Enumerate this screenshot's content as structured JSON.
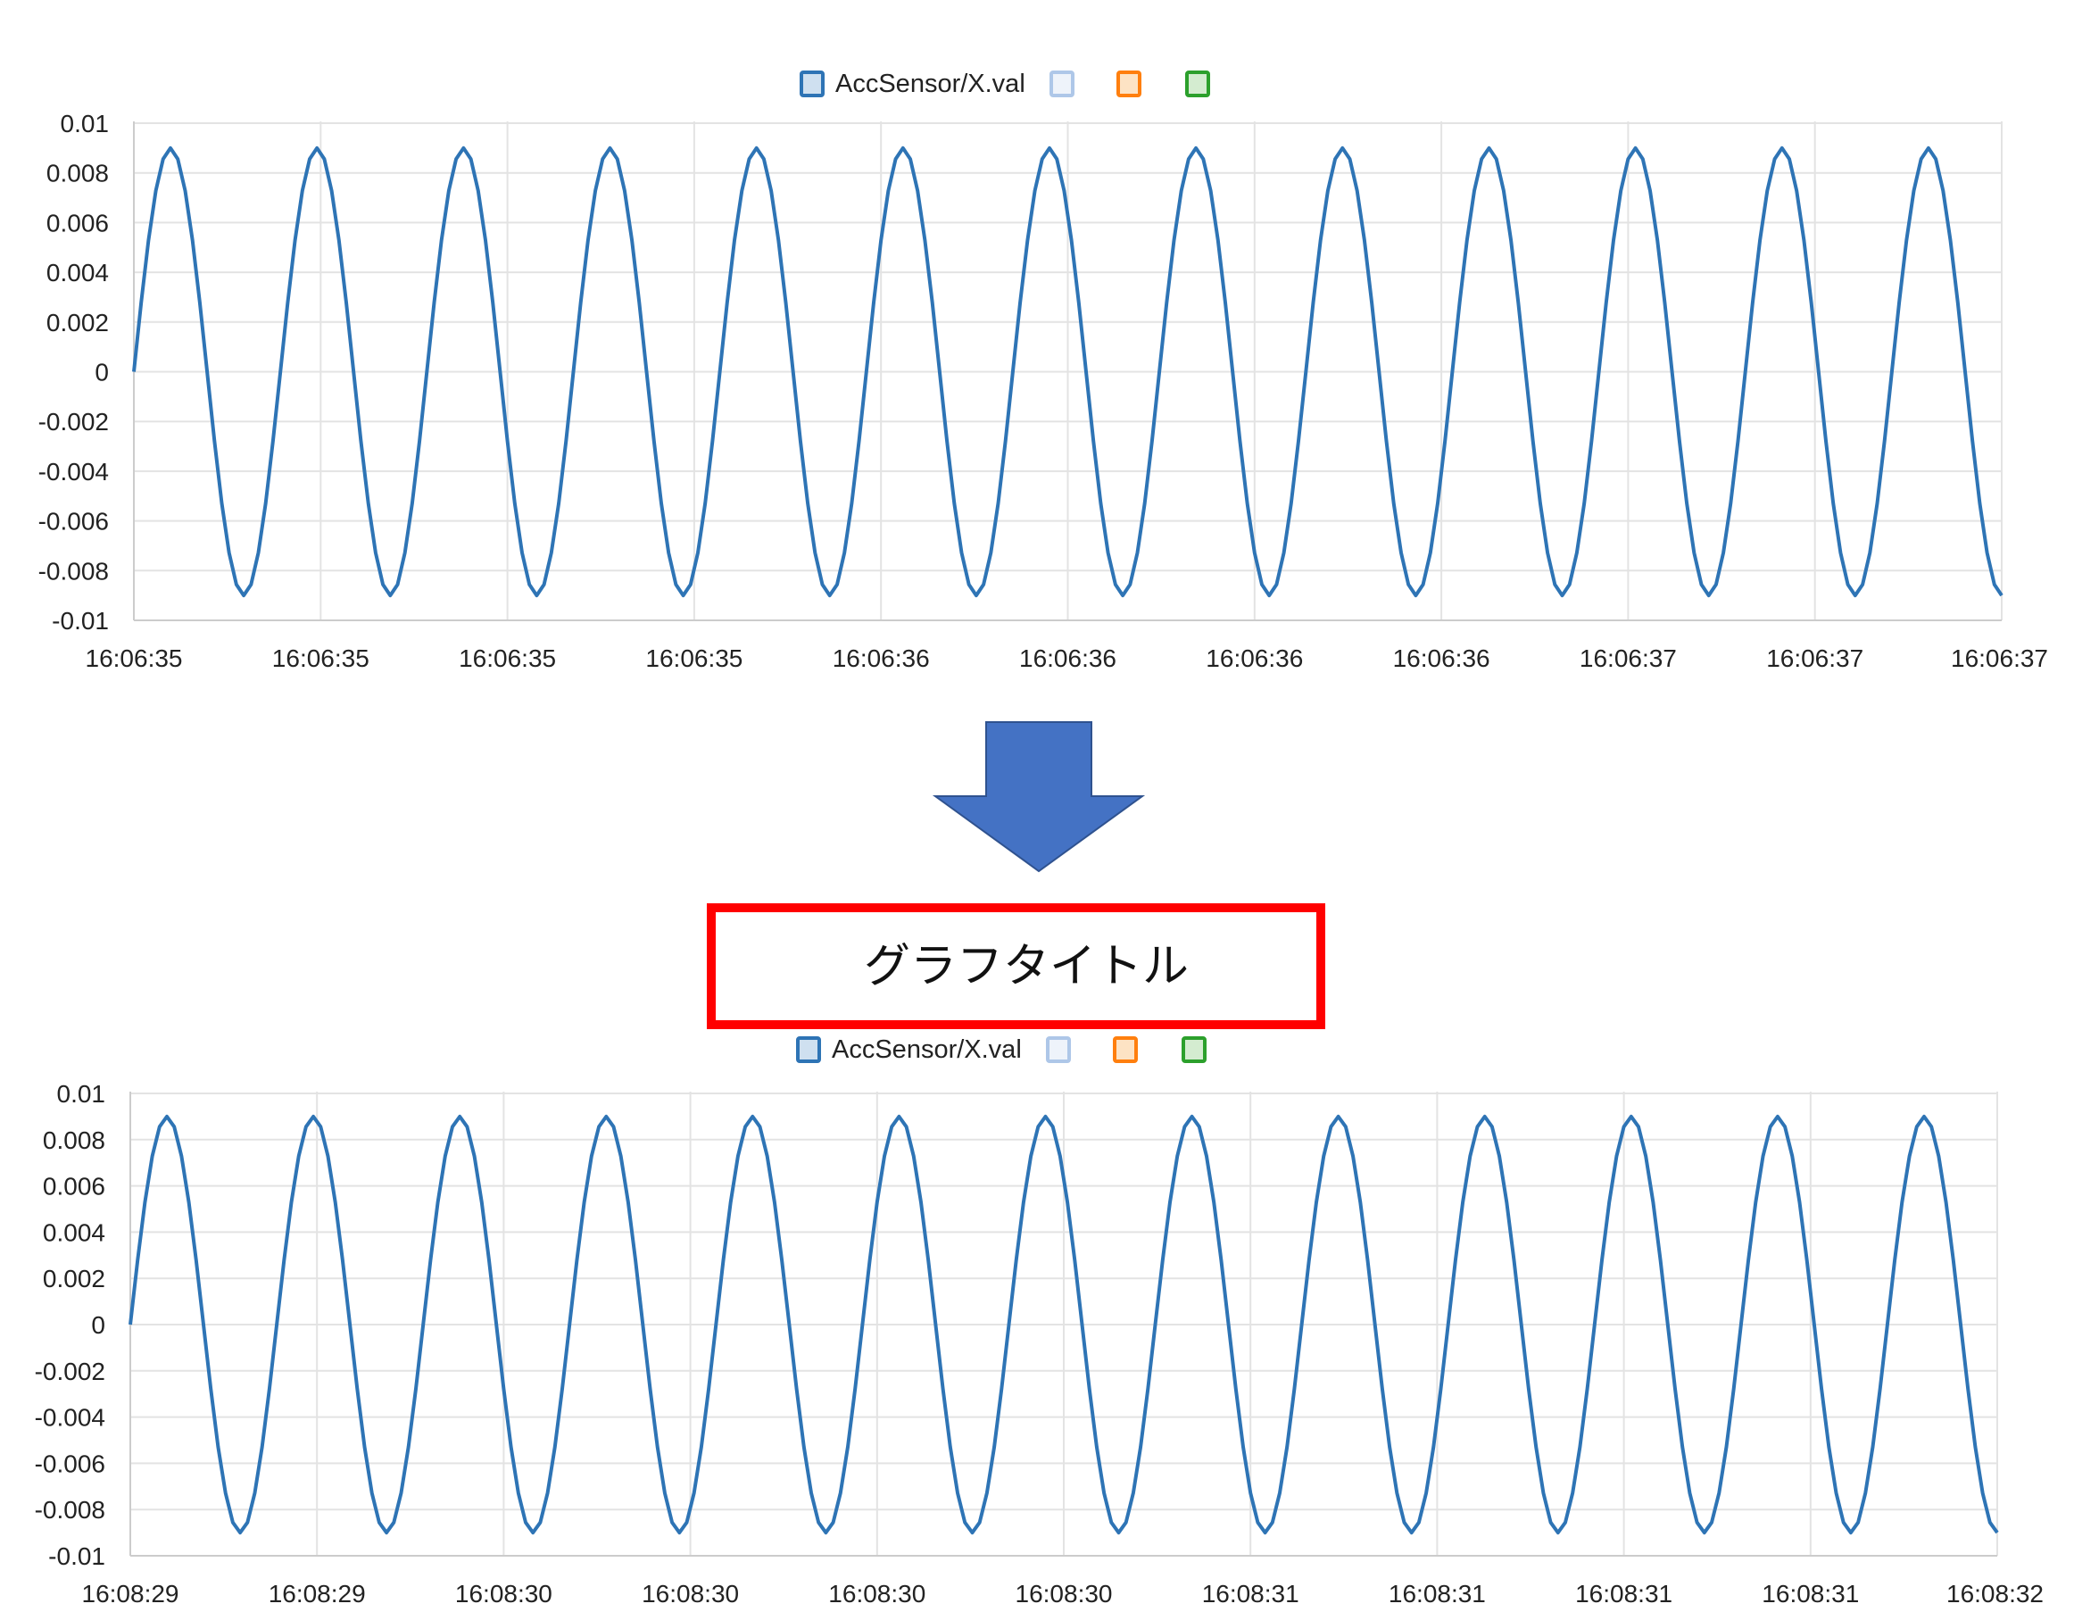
{
  "colors": {
    "series": "#2e74b5",
    "legend_swatches": [
      "#2e74b5",
      "#aec7e8",
      "#ff7f0e",
      "#2ca02c"
    ],
    "grid": "#e3e3e3",
    "axis": "#cccccc",
    "arrow_fill": "#4472c4",
    "arrow_stroke": "#2f528f",
    "title_box": "#ff0000"
  },
  "arrow": {
    "icon": "down-arrow-icon"
  },
  "chart_data": [
    {
      "type": "line",
      "title": "",
      "xlabel": "",
      "ylabel": "",
      "ylim": [
        -0.01,
        0.01
      ],
      "grid": true,
      "legend_placement": "top-center",
      "legend": [
        "AccSensor/X.val",
        "",
        "",
        ""
      ],
      "yticks": [
        "0.01",
        "0.008",
        "0.006",
        "0.004",
        "0.002",
        "0",
        "-0.002",
        "-0.004",
        "-0.006",
        "-0.008",
        "-0.01"
      ],
      "xticks": [
        "16:06:35",
        "16:06:35",
        "16:06:35",
        "16:06:35",
        "16:06:36",
        "16:06:36",
        "16:06:36",
        "16:06:36",
        "16:06:37",
        "16:06:37",
        "16:06:37"
      ],
      "series": [
        {
          "name": "AccSensor/X.val",
          "waveform": "sine",
          "amplitude": 0.009,
          "cycles": 12.75,
          "start_value": 0
        }
      ]
    },
    {
      "type": "line",
      "title": "グラフタイトル",
      "xlabel": "",
      "ylabel": "",
      "ylim": [
        -0.01,
        0.01
      ],
      "grid": true,
      "legend_placement": "top-center",
      "legend": [
        "AccSensor/X.val",
        "",
        "",
        ""
      ],
      "yticks": [
        "0.01",
        "0.008",
        "0.006",
        "0.004",
        "0.002",
        "0",
        "-0.002",
        "-0.004",
        "-0.006",
        "-0.008",
        "-0.01"
      ],
      "xticks": [
        "16:08:29",
        "16:08:29",
        "16:08:30",
        "16:08:30",
        "16:08:30",
        "16:08:30",
        "16:08:31",
        "16:08:31",
        "16:08:31",
        "16:08:31",
        "16:08:32"
      ],
      "series": [
        {
          "name": "AccSensor/X.val",
          "waveform": "sine",
          "amplitude": 0.009,
          "cycles": 12.75,
          "start_value": 0
        }
      ]
    }
  ]
}
